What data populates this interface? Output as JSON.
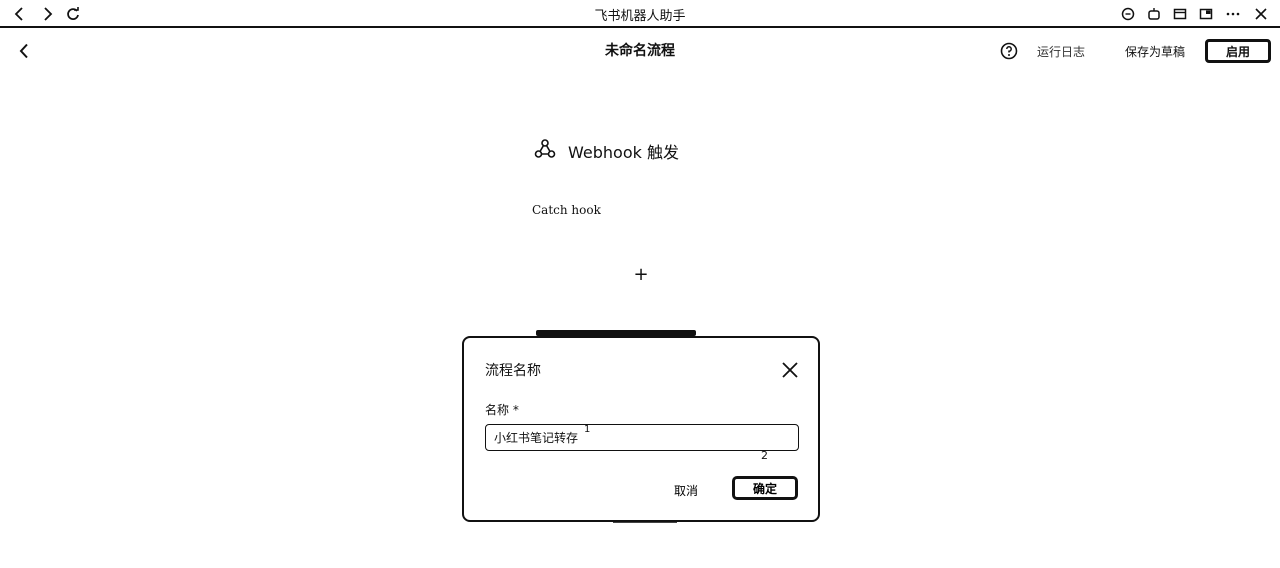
{
  "browser": {
    "title": "飞书机器人助手"
  },
  "header": {
    "title": "未命名流程",
    "run_log": "运行日志",
    "save_draft": "保存为草稿",
    "enable": "启用"
  },
  "canvas": {
    "trigger_label": "Webhook 触发",
    "catch_hook": "Catch hook",
    "add_symbol": "+"
  },
  "dialog": {
    "title": "流程名称",
    "name_label": "名称",
    "required_mark": "*",
    "name_value": "小红书笔记转存",
    "annotation_1": "1",
    "annotation_2": "2",
    "cancel": "取消",
    "confirm": "确定"
  },
  "icons": [
    "back-icon",
    "forward-icon",
    "refresh-icon",
    "chat-icon",
    "robot-icon",
    "window-icon",
    "pip-icon",
    "more-icon",
    "close-icon",
    "help-icon",
    "webhook-icon"
  ]
}
